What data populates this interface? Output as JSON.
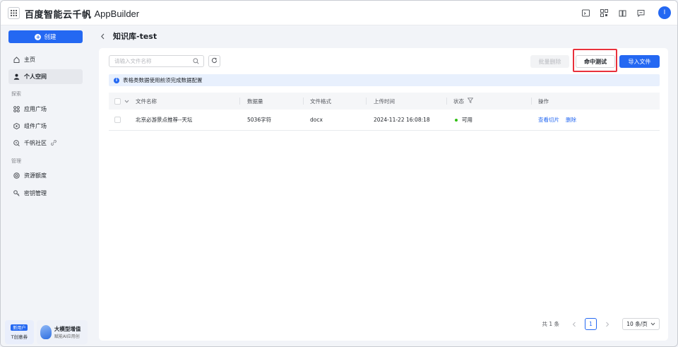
{
  "header": {
    "brand_cn": "百度智能云千帆",
    "brand_en": "AppBuilder",
    "icons": [
      "terminal-icon",
      "qrcode-icon",
      "book-icon",
      "message-icon"
    ],
    "avatar_initial": "I"
  },
  "sidebar": {
    "create_label": "创建",
    "items": [
      {
        "label": "主页",
        "icon": "home-icon"
      },
      {
        "label": "个人空间",
        "icon": "user-icon",
        "active": true
      }
    ],
    "group_explore": "探索",
    "explore_items": [
      {
        "label": "应用广场",
        "icon": "apps-icon"
      },
      {
        "label": "组件广场",
        "icon": "component-icon"
      },
      {
        "label": "千帆社区",
        "icon": "community-icon"
      }
    ],
    "group_manage": "管理",
    "manage_items": [
      {
        "label": "资源额度",
        "icon": "resource-icon"
      },
      {
        "label": "密钥管理",
        "icon": "key-icon"
      }
    ],
    "promo": {
      "badge": "新用户",
      "card1_text": "T创意券",
      "title": "大模型增值",
      "subtitle": "赋能AI应用创"
    }
  },
  "page": {
    "title": "知识库-test"
  },
  "toolbar": {
    "search_placeholder": "请输入文件名称",
    "batch_delete_label": "批量删除",
    "hit_test_label": "命中测试",
    "import_label": "导入文件"
  },
  "notice": {
    "text": "表格类数据使用前须完成数据配置"
  },
  "table": {
    "headers": {
      "file_name": "文件名称",
      "data_size": "数据量",
      "file_format": "文件格式",
      "upload_time": "上传时间",
      "status": "状态",
      "actions": "操作"
    },
    "rows": [
      {
        "file_name": "北京必游景点推荐--天坛",
        "data_size": "5036字符",
        "file_format": "docx",
        "upload_time": "2024-11-22 16:08:18",
        "status": "可用",
        "action_view": "查看切片",
        "action_delete": "删除"
      }
    ]
  },
  "pagination": {
    "total": "共 1 条",
    "current_page": "1",
    "page_size": "10 条/页"
  },
  "colors": {
    "primary": "#2468f2",
    "highlight": "#e8313c",
    "status_ok": "#30bf13"
  }
}
